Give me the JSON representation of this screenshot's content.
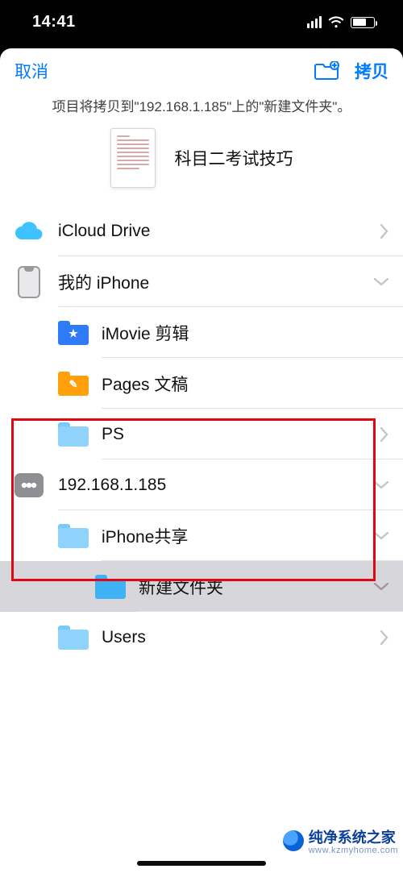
{
  "status": {
    "time": "14:41"
  },
  "nav": {
    "cancel": "取消",
    "copy": "拷贝"
  },
  "subtitle": "项目将拷贝到\"192.168.1.185\"上的\"新建文件夹\"。",
  "preview": {
    "filename": "科目二考试技巧"
  },
  "rows": {
    "icloud": "iCloud Drive",
    "myiphone": "我的 iPhone",
    "imovie": "iMovie 剪辑",
    "pages": "Pages 文稿",
    "ps": "PS",
    "server": "192.168.1.185",
    "share": "iPhone共享",
    "newfolder": "新建文件夹",
    "users": "Users"
  },
  "icons": {
    "imovie_glyph": "★",
    "pages_glyph": "✎"
  },
  "watermark": {
    "title": "纯净系统之家",
    "url": "www.kzmyhome.com"
  }
}
